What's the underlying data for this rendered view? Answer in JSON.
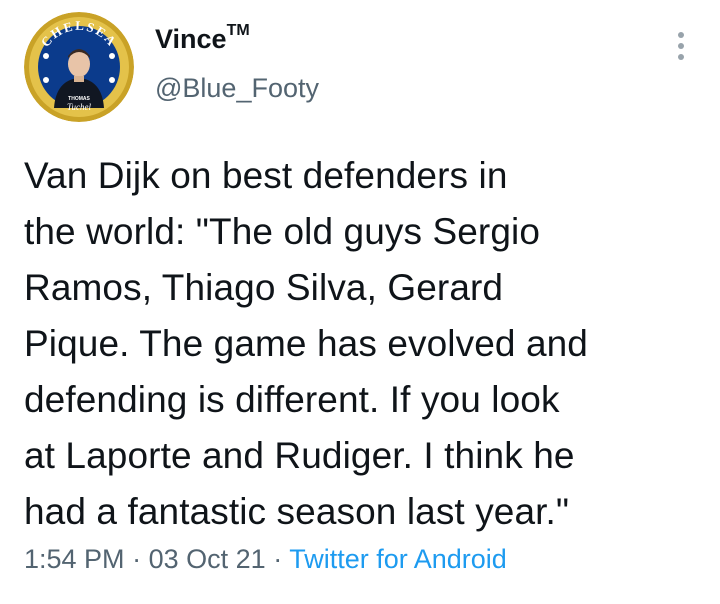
{
  "user": {
    "display_name": "Vince",
    "trademark": "TM",
    "handle": "@Blue_Footy",
    "avatar": {
      "top_text": "CHELSEA",
      "player_label": "THOMAS",
      "signature": "Tuchel",
      "ring_color": "#c9a227",
      "fill_color": "#0b3b8c"
    }
  },
  "more_icon": "more-vertical-icon",
  "tweet": {
    "lines": [
      "Van Dijk on best defenders in",
      "the world: \"The old guys Sergio",
      "Ramos, Thiago Silva, Gerard",
      "Pique. The game has evolved and",
      "defending is different. If you look",
      "at Laporte and Rudiger. I think he",
      "had a fantastic season last year.\""
    ]
  },
  "meta": {
    "time": "1:54 PM",
    "separator": "·",
    "date": "03 Oct 21",
    "source": "Twitter for Android"
  },
  "colors": {
    "text": "#0f1419",
    "secondary": "#536471",
    "link": "#1d9bf0"
  }
}
